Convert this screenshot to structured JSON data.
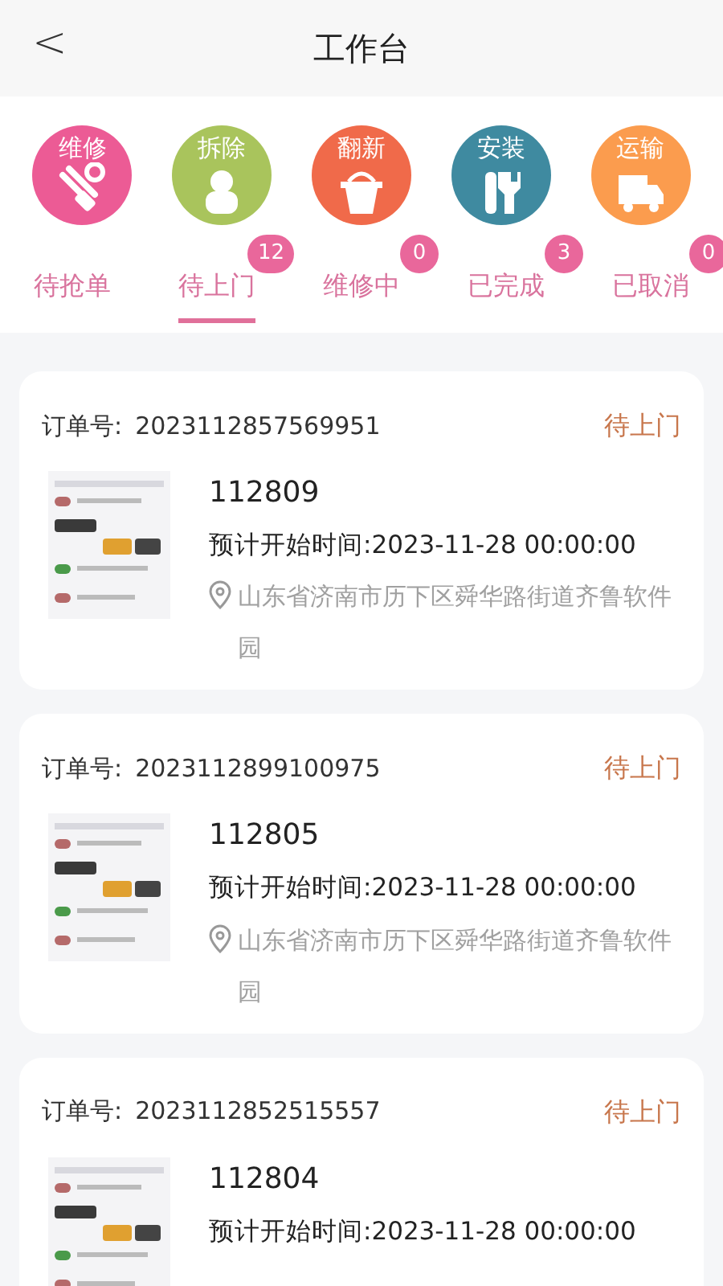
{
  "header": {
    "back": "<",
    "title": "工作台"
  },
  "categories": [
    {
      "label": "维修",
      "kind": "repair",
      "color": "#ec5b95"
    },
    {
      "label": "拆除",
      "kind": "demolish",
      "color": "#a9c45c"
    },
    {
      "label": "翻新",
      "kind": "renovate",
      "color": "#f06a4a"
    },
    {
      "label": "安装",
      "kind": "install",
      "color": "#3f8aa0"
    },
    {
      "label": "运输",
      "kind": "transport",
      "color": "#fb9c4e"
    }
  ],
  "tabs": [
    {
      "label": "待抢单",
      "selected": false
    },
    {
      "label": "待上门",
      "selected": true,
      "badge": "12"
    },
    {
      "label": "维修中",
      "selected": false,
      "badge": "0"
    },
    {
      "label": "已完成",
      "selected": false,
      "badge": "3"
    },
    {
      "label": "已取消",
      "selected": false,
      "badge": "0"
    }
  ],
  "orders": [
    {
      "order_label": "订单号:",
      "order_no": "2023112857569951",
      "status": "待上门",
      "title": "112809",
      "start_time": "预计开始时间:2023-11-28 00:00:00",
      "address": "山东省济南市历下区舜华路街道齐鲁软件园"
    },
    {
      "order_label": "订单号:",
      "order_no": "2023112899100975",
      "status": "待上门",
      "title": "112805",
      "start_time": "预计开始时间:2023-11-28 00:00:00",
      "address": "山东省济南市历下区舜华路街道齐鲁软件园"
    },
    {
      "order_label": "订单号:",
      "order_no": "2023112852515557",
      "status": "待上门",
      "title": "112804",
      "start_time": "预计开始时间:2023-11-28 00:00:00"
    }
  ]
}
